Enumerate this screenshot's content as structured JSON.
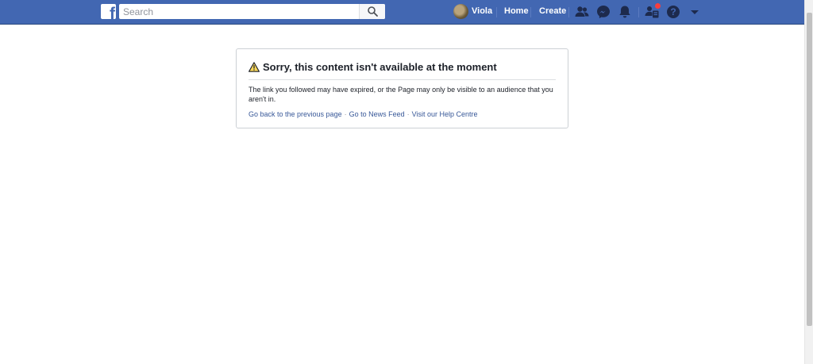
{
  "header": {
    "logo_letter": "f",
    "search_placeholder": "Search",
    "profile_name": "Viola",
    "nav": {
      "home": "Home",
      "create": "Create"
    },
    "icons": [
      "friend-requests-icon",
      "messenger-icon",
      "notifications-icon",
      "quick-help-icon",
      "help-icon",
      "account-menu-icon"
    ],
    "colors": {
      "bar": "#4267b2",
      "badge": "#fa3e3e"
    }
  },
  "error_card": {
    "title": "Sorry, this content isn't available at the moment",
    "message": "The link you followed may have expired, or the Page may only be visible to an audience that you aren't in.",
    "links": {
      "back": "Go back to the previous page",
      "news_feed": "Go to News Feed",
      "help": "Visit our Help Centre"
    },
    "separator": "·"
  }
}
